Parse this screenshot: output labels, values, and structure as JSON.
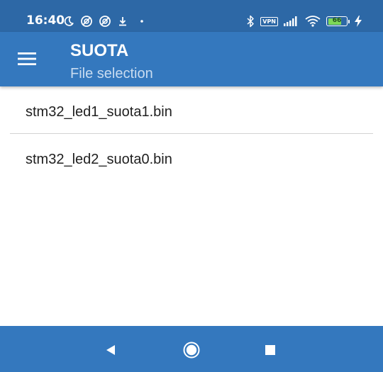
{
  "status_bar": {
    "time": "16:40",
    "left_icons": [
      "moon-icon",
      "data-saver-icon",
      "data-saver-icon",
      "download-icon",
      "dot-icon"
    ],
    "vpn_label": "VPN",
    "battery_level": "66",
    "right_icons": [
      "bluetooth-icon",
      "vpn-icon",
      "signal-icon",
      "wifi-icon",
      "battery-icon",
      "charging-bolt-icon"
    ]
  },
  "app_bar": {
    "title": "SUOTA",
    "subtitle": "File selection",
    "menu_icon": "hamburger-menu-icon"
  },
  "file_list": {
    "items": [
      {
        "label": "stm32_led1_suota1.bin"
      },
      {
        "label": "stm32_led2_suota0.bin"
      }
    ]
  },
  "nav_bar": {
    "buttons": [
      "back-icon",
      "home-icon",
      "recents-icon"
    ]
  },
  "colors": {
    "status_bar": "#2d68a6",
    "app_bar": "#3478be",
    "nav_bar": "#3478be",
    "subtitle": "#c9dcf0",
    "battery_fill": "#7ed957"
  }
}
